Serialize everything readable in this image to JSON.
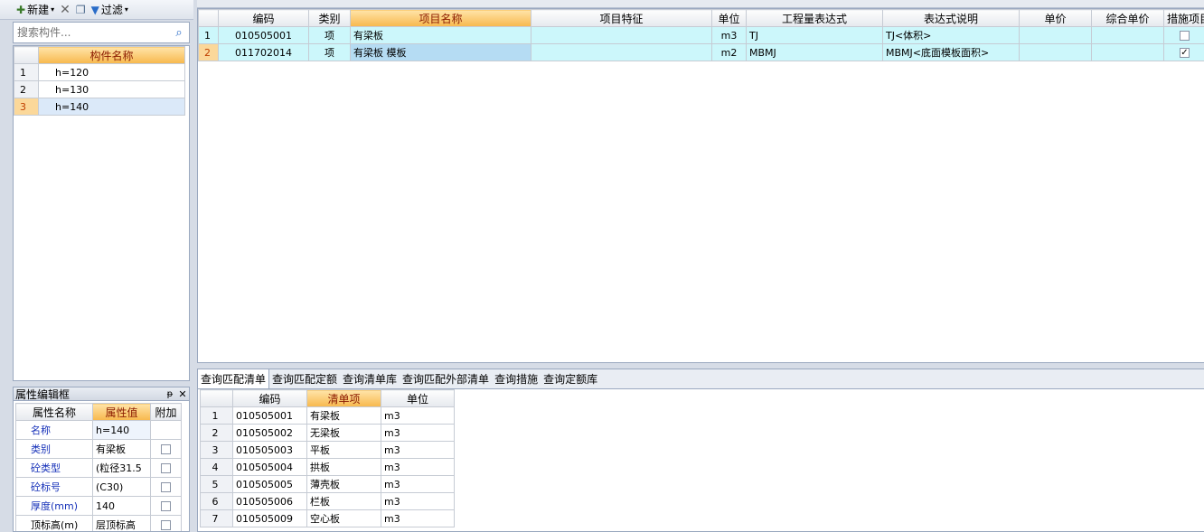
{
  "left_toolbar": {
    "new_label": "新建",
    "filter_label": "过滤"
  },
  "search": {
    "placeholder": "搜索构件..."
  },
  "component_list": {
    "header": "构件名称",
    "rows": [
      {
        "num": "1",
        "name": "h=120"
      },
      {
        "num": "2",
        "name": "h=130"
      },
      {
        "num": "3",
        "name": "h=140"
      }
    ]
  },
  "property_panel": {
    "title": "属性编辑框",
    "headers": {
      "name": "属性名称",
      "value": "属性值",
      "extra": "附加"
    },
    "rows": [
      {
        "name": "名称",
        "value": "h=140"
      },
      {
        "name": "类别",
        "value": "有梁板"
      },
      {
        "name": "砼类型",
        "value": "(粒径31.5"
      },
      {
        "name": "砼标号",
        "value": "(C30)"
      },
      {
        "name": "厚度(mm)",
        "value": "140"
      },
      {
        "name": "顶标高(m)",
        "value": "层顶标高"
      }
    ]
  },
  "main_table": {
    "headers": [
      "编码",
      "类别",
      "项目名称",
      "项目特征",
      "单位",
      "工程量表达式",
      "表达式说明",
      "单价",
      "综合单价",
      "措施项目"
    ],
    "rows": [
      {
        "num": "1",
        "code": "010505001",
        "type": "项",
        "name": "有梁板",
        "feature": "",
        "unit": "m3",
        "expr": "TJ",
        "desc": "TJ<体积>",
        "price": "",
        "total": "",
        "measure": false
      },
      {
        "num": "2",
        "code": "011702014",
        "type": "项",
        "name": "有梁板 模板",
        "feature": "",
        "unit": "m2",
        "expr": "MBMJ",
        "desc": "MBMJ<底面模板面积>",
        "price": "",
        "total": "",
        "measure": true
      }
    ]
  },
  "tabs": [
    "查询匹配清单",
    "查询匹配定额",
    "查询清单库",
    "查询匹配外部清单",
    "查询措施",
    "查询定额库"
  ],
  "lower_table": {
    "headers": [
      "编码",
      "清单项",
      "单位"
    ],
    "rows": [
      {
        "num": "1",
        "code": "010505001",
        "name": "有梁板",
        "unit": "m3"
      },
      {
        "num": "2",
        "code": "010505002",
        "name": "无梁板",
        "unit": "m3"
      },
      {
        "num": "3",
        "code": "010505003",
        "name": "平板",
        "unit": "m3"
      },
      {
        "num": "4",
        "code": "010505004",
        "name": "拱板",
        "unit": "m3"
      },
      {
        "num": "5",
        "code": "010505005",
        "name": "薄壳板",
        "unit": "m3"
      },
      {
        "num": "6",
        "code": "010505006",
        "name": "栏板",
        "unit": "m3"
      },
      {
        "num": "7",
        "code": "010505009",
        "name": "空心板",
        "unit": "m3"
      }
    ]
  }
}
